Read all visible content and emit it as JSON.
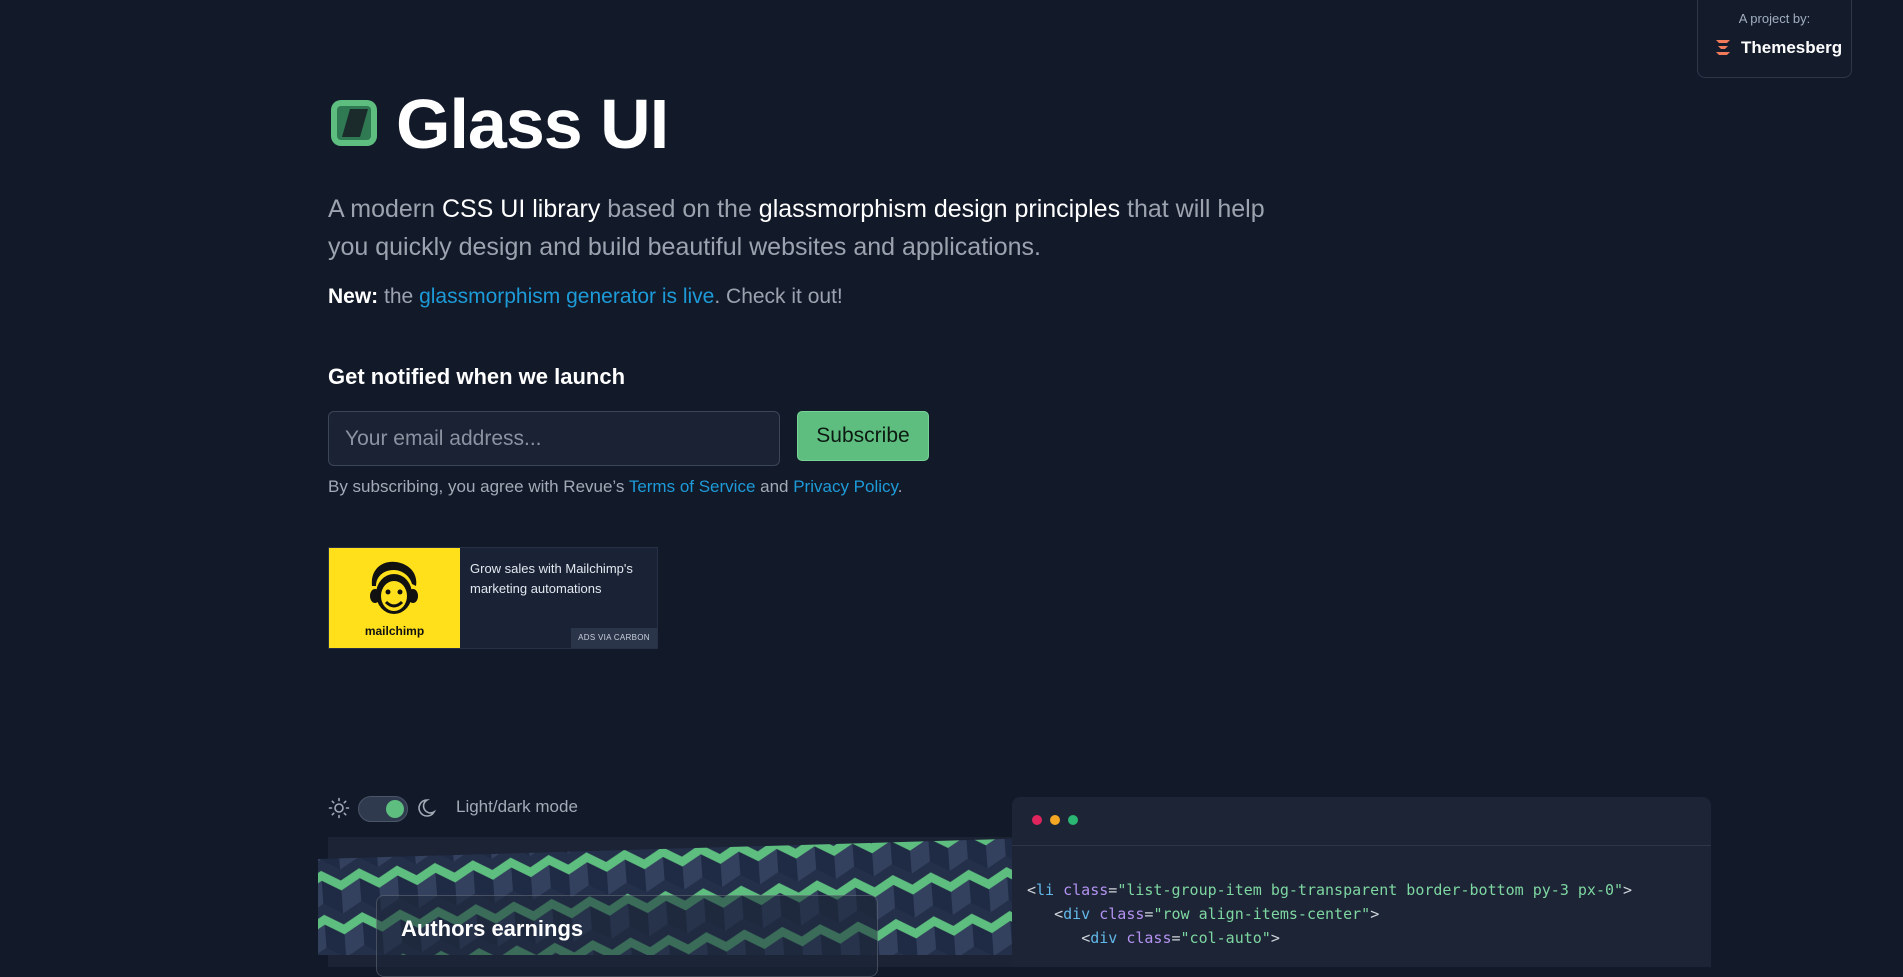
{
  "project": {
    "caption": "A project by:",
    "brand": "Themesberg"
  },
  "hero": {
    "title": "Glass UI",
    "lead_1": "A modern ",
    "lead_strong_1": "CSS UI library",
    "lead_2": " based on the ",
    "lead_strong_2": "glassmorphism design principles",
    "lead_3": " that will help you quickly design and build beautiful websites and applications.",
    "news_label": "New:",
    "news_pre": " the ",
    "news_link": "glassmorphism generator is live",
    "news_post": ". Check it out!"
  },
  "subscribe": {
    "title": "Get notified when we launch",
    "placeholder": "Your email address...",
    "button": "Subscribe",
    "legal_pre": "By subscribing, you agree with Revue’s ",
    "terms": "Terms of Service",
    "legal_and": " and ",
    "privacy": "Privacy Policy",
    "legal_post": "."
  },
  "ad": {
    "brand": "mailchimp",
    "text": "Grow sales with Mailchimp's marketing automations",
    "tag": "ADS VIA CARBON"
  },
  "mode": {
    "label": "Light/dark mode",
    "enabled": true
  },
  "preview": {
    "card_title": "Authors earnings",
    "dots": [
      "#e0245e",
      "#f5a623",
      "#2bb673"
    ],
    "pattern_colors": {
      "green": "#5ebe7f",
      "dark": "#1f2a44"
    },
    "code": [
      {
        "indent": "",
        "el": "li",
        "attr": "class",
        "val": "\"list-group-item bg-transparent border-bottom py-3 px-0\""
      },
      {
        "indent": "   ",
        "el": "div",
        "attr": "class",
        "val": "\"row align-items-center\""
      },
      {
        "indent": "      ",
        "el": "div",
        "attr": "class",
        "val": "\"col-auto\""
      }
    ]
  }
}
